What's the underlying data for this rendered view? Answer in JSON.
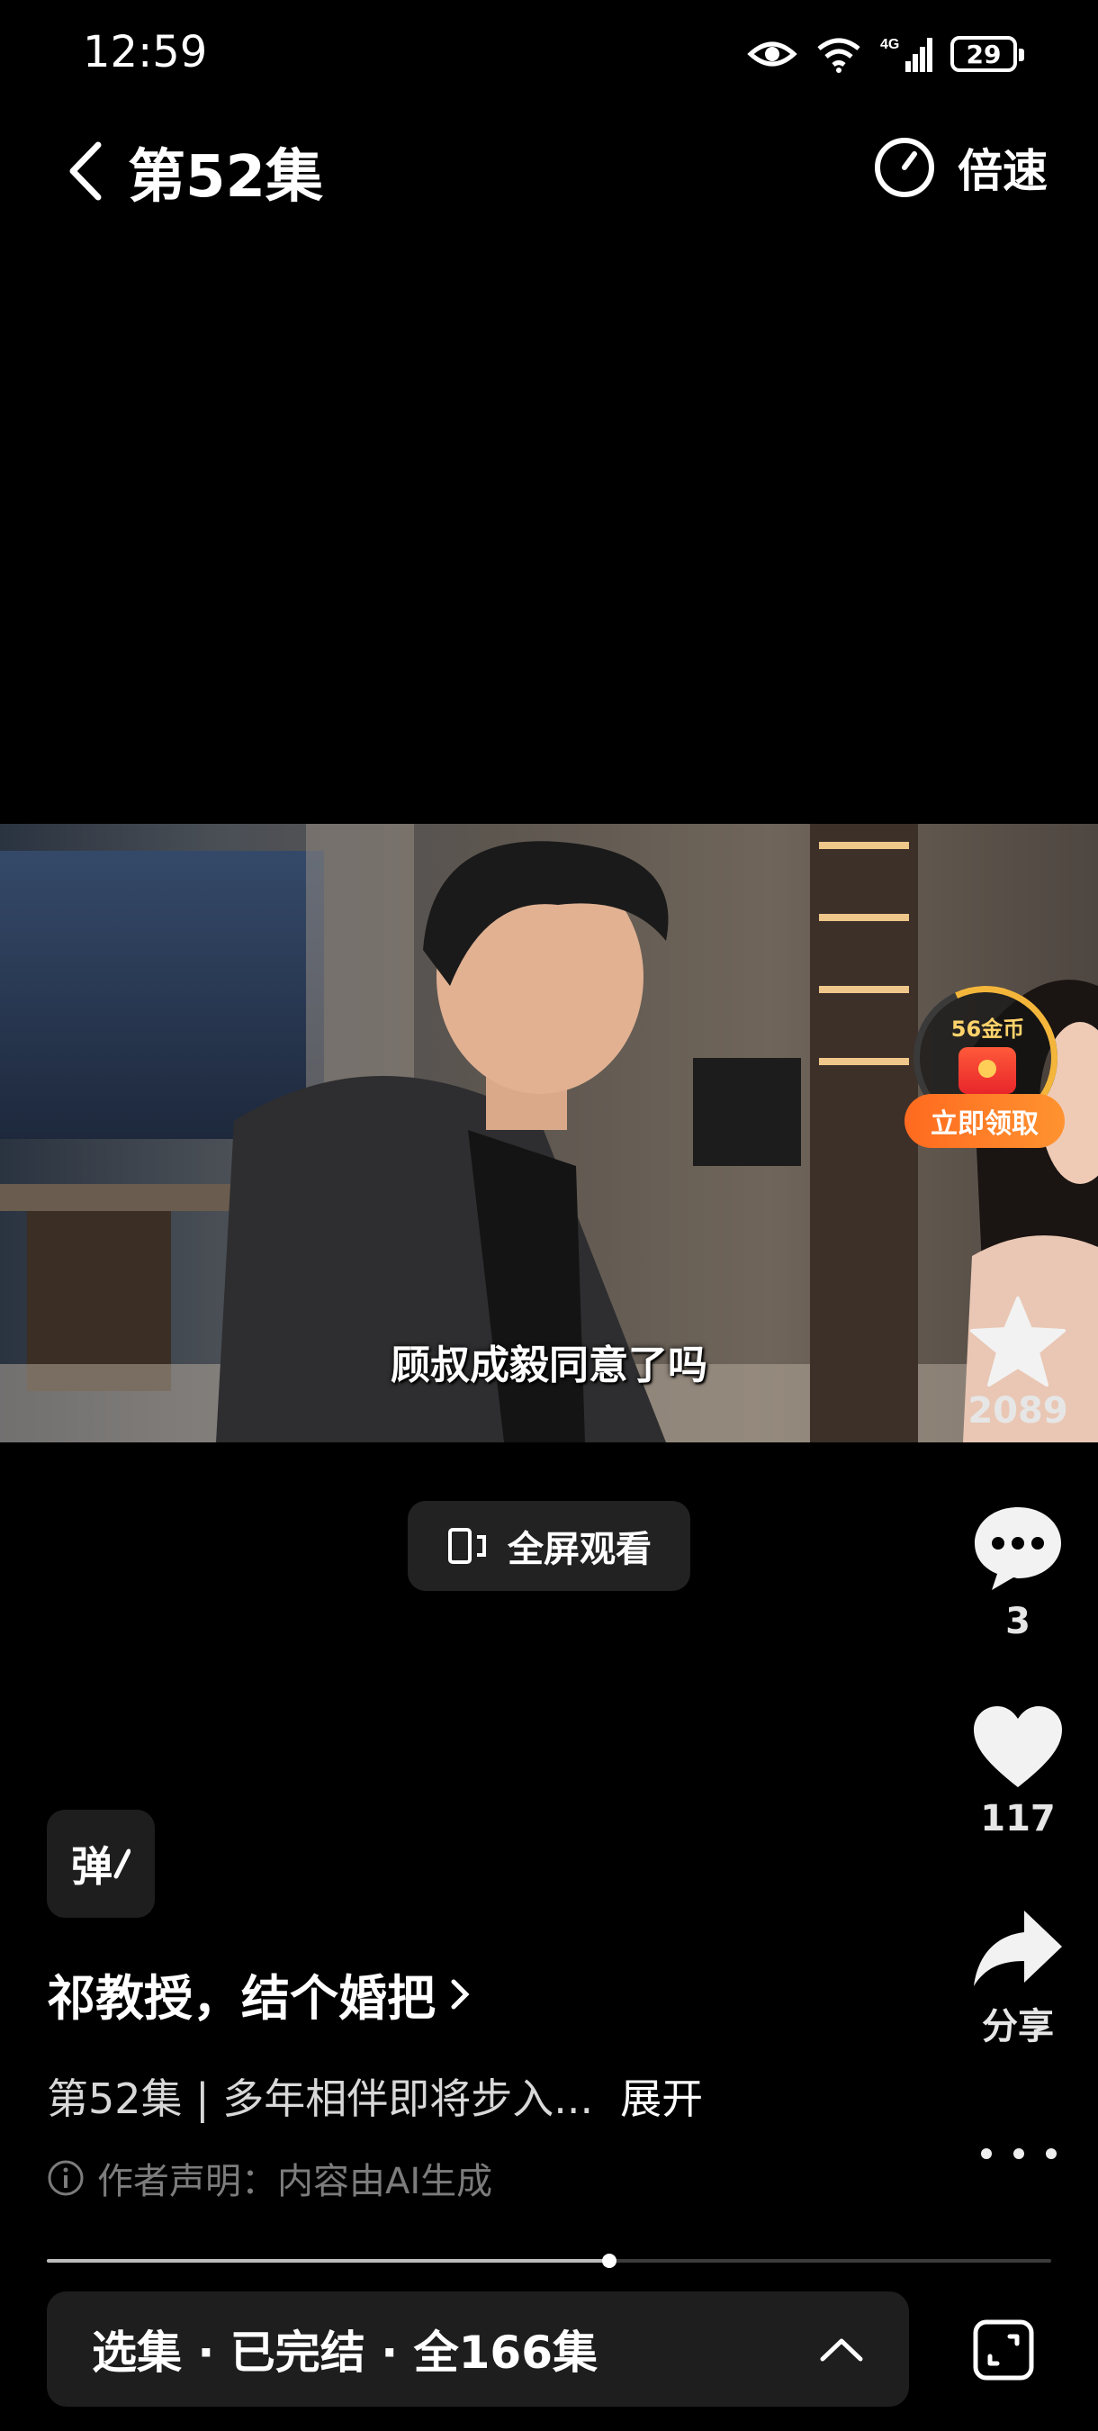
{
  "status_bar": {
    "time": "12:59",
    "battery": "29",
    "icons": [
      "eye-icon",
      "wifi-icon",
      "signal-4g-icon",
      "battery-icon"
    ]
  },
  "header": {
    "title": "第52集",
    "speed_label": "倍速"
  },
  "video": {
    "subtitle": "顾叔成毅同意了吗"
  },
  "coin_widget": {
    "amount": "56金币",
    "claim_label": "立即领取"
  },
  "actions": {
    "favorite_count": "2089",
    "comment_count": "3",
    "like_count": "117",
    "share_label": "分享"
  },
  "fullscreen_label": "全屏观看",
  "danmaku_label": "弹",
  "drama": {
    "title": "祁教授，结个婚把",
    "description": "第52集 | 多年相伴即将步入...",
    "expand_label": "展开",
    "disclaimer": "作者声明：内容由AI生成"
  },
  "playback": {
    "progress": 0.56
  },
  "episode_bar": {
    "label": "选集 · 已完结 · 全166集"
  },
  "colors": {
    "accent_orange": "#ff7a22",
    "coin_gold": "#f4b63a"
  }
}
